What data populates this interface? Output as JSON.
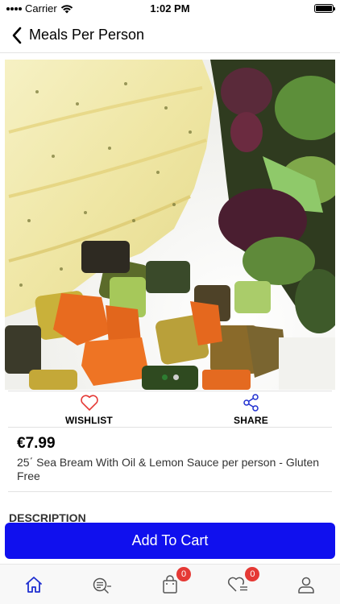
{
  "status_bar": {
    "carrier": "Carrier",
    "time": "1:02 PM"
  },
  "nav": {
    "title": "Meals Per Person",
    "back_icon": "chevron-left-icon"
  },
  "product": {
    "image": "sea-bream-with-vegetables-photo",
    "carousel": {
      "count": 2,
      "active": 1
    },
    "price": "€7.99",
    "name": "25΄ Sea Bream With Oil & Lemon Sauce per person - Gluten Free"
  },
  "actions": {
    "wishlist": {
      "label": "WISHLIST",
      "icon": "heart-icon"
    },
    "share": {
      "label": "SHARE",
      "icon": "share-icon"
    }
  },
  "description": {
    "heading": "DESCRIPTION"
  },
  "cart": {
    "button_label": "Add To Cart"
  },
  "tab_bar": {
    "items": [
      {
        "name": "home",
        "icon": "home-icon",
        "active": true
      },
      {
        "name": "search",
        "icon": "search-list-icon"
      },
      {
        "name": "cart",
        "icon": "shopping-bag-icon",
        "badge": "0"
      },
      {
        "name": "wishlist",
        "icon": "heart-list-icon",
        "badge": "0"
      },
      {
        "name": "profile",
        "icon": "user-icon"
      }
    ]
  },
  "colors": {
    "accent": "#1010ee",
    "heart": "#e53935",
    "badge": "#e53935",
    "active_tab": "#1f2fd0"
  }
}
